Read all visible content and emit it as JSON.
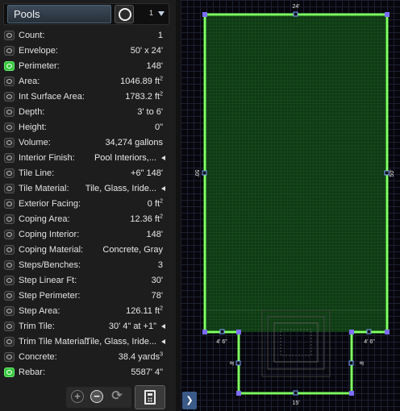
{
  "panel": {
    "title": "Pools",
    "count": "1",
    "rows": [
      {
        "label": "Count:",
        "value": "1",
        "on": false
      },
      {
        "label": "Envelope:",
        "value": "50' x 24'",
        "on": false
      },
      {
        "label": "Perimeter:",
        "value": "148'",
        "on": true
      },
      {
        "label": "Area:",
        "value": "1046.89 ft",
        "sup": "2",
        "on": false
      },
      {
        "label": "Int Surface Area:",
        "value": "1783.2 ft",
        "sup": "2",
        "on": false
      },
      {
        "label": "Depth:",
        "value": "3' to 6'",
        "on": false
      },
      {
        "label": "Height:",
        "value": "0\"",
        "on": false
      },
      {
        "label": "Volume:",
        "value": "34,274 gallons",
        "on": false
      },
      {
        "label": "Interior Finish:",
        "value": "Pool Interiors,...",
        "arrow": true,
        "on": false
      },
      {
        "label": "Tile Line:",
        "value": "+6\" 148'",
        "on": false
      },
      {
        "label": "Tile Material:",
        "value": "Tile, Glass, Iride...",
        "arrow": true,
        "on": false
      },
      {
        "label": "Exterior Facing:",
        "value": "0 ft",
        "sup": "2",
        "on": false
      },
      {
        "label": "Coping Area:",
        "value": "12.36 ft",
        "sup": "2",
        "on": false
      },
      {
        "label": "Coping Interior:",
        "value": "148'",
        "on": false
      },
      {
        "label": "Coping Material:",
        "value": "Concrete, Gray",
        "on": false
      },
      {
        "label": "Steps/Benches:",
        "value": "3",
        "on": false
      },
      {
        "label": "Step Linear Ft:",
        "value": "30'",
        "on": false
      },
      {
        "label": "Step Perimeter:",
        "value": "78'",
        "on": false
      },
      {
        "label": "Step Area:",
        "value": "126.11 ft",
        "sup": "2",
        "on": false
      },
      {
        "label": "Trim Tile:",
        "value": "30' 4\" at +1\"",
        "arrow": true,
        "on": false
      },
      {
        "label": "Trim Tile Material:",
        "value": "Tile, Glass, Iride...",
        "arrow": true,
        "on": false
      },
      {
        "label": "Concrete:",
        "value": "38.4 yards",
        "sup": "3",
        "on": false
      },
      {
        "label": "Rebar:",
        "value": "5587' 4\"",
        "on": true
      }
    ]
  },
  "toolbar": {
    "add_icon": "plus-circle-icon",
    "remove_icon": "minus-circle-icon",
    "refresh_icon": "refresh-icon",
    "calculator_icon": "calculator-icon",
    "expand_icon": "chevron-right-icon"
  },
  "plan": {
    "top_dim": "24'",
    "left_dim": "50'",
    "right_dim": "50'",
    "step_left_dim": "4' 6\"",
    "step_right_dim": "4' 6\"",
    "step_side_left": "8'",
    "step_side_right": "8'",
    "bottom_dim": "15'",
    "colors": {
      "outline": "#5dff3a",
      "fill": "#0f3a14",
      "handle": "#7c6cff"
    }
  }
}
